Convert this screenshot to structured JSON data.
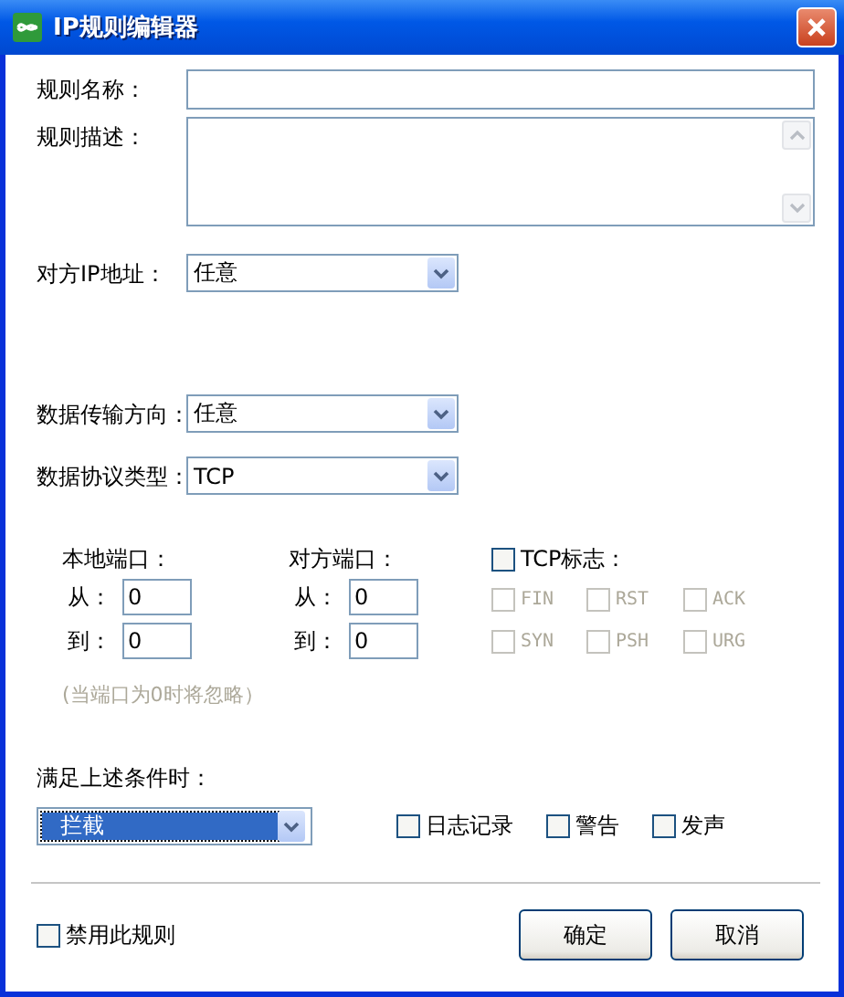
{
  "window": {
    "title": "IP规则编辑器"
  },
  "fields": [
    {
      "kind": "text",
      "label": "规则名称："
    },
    {
      "kind": "textarea",
      "label": "规则描述："
    }
  ],
  "remote_ip": {
    "label": "对方IP地址：",
    "value": "任意"
  },
  "direction": {
    "label": "数据传输方向：",
    "value": "任意"
  },
  "protocol": {
    "label": "数据协议类型：",
    "value": "TCP"
  },
  "ports": [
    {
      "label": "本地端口：",
      "from_label": "从：",
      "from_value": "0",
      "to_label": "到：",
      "to_value": "0"
    },
    {
      "label": "对方端口：",
      "from_label": "从：",
      "from_value": "0",
      "to_label": "到：",
      "to_value": "0"
    }
  ],
  "tcp_flags": {
    "label": "TCP标志：",
    "checked": false,
    "flags": [
      {
        "label": "FIN",
        "checked": false,
        "disabled": true
      },
      {
        "label": "RST",
        "checked": false,
        "disabled": true
      },
      {
        "label": "ACK",
        "checked": false,
        "disabled": true
      },
      {
        "label": "SYN",
        "checked": false,
        "disabled": true
      },
      {
        "label": "PSH",
        "checked": false,
        "disabled": true
      },
      {
        "label": "URG",
        "checked": false,
        "disabled": true
      }
    ]
  },
  "port_hint": "(当端口为0时将忽略）",
  "action": {
    "label": "满足上述条件时：",
    "value": "拦截",
    "focused": true
  },
  "options": [
    {
      "label": "日志记录",
      "checked": false
    },
    {
      "label": "警告",
      "checked": false
    },
    {
      "label": "发声",
      "checked": false
    }
  ],
  "disable_rule": {
    "label": "禁用此规则",
    "checked": false
  },
  "buttons": [
    "确定",
    "取消"
  ]
}
